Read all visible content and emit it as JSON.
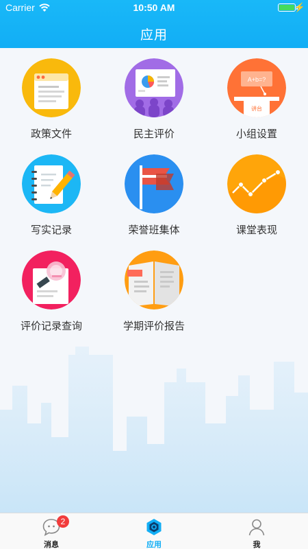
{
  "status_bar": {
    "carrier": "Carrier",
    "time": "10:50 AM",
    "battery_level": 1.0
  },
  "header": {
    "title": "应用"
  },
  "apps": [
    {
      "label": "政策文件",
      "icon": "policy-document-icon",
      "color": "#f9b90c"
    },
    {
      "label": "民主评价",
      "icon": "presentation-icon",
      "color": "#a16ce6"
    },
    {
      "label": "小组设置",
      "icon": "lectern-icon",
      "color": "#ff7236",
      "board_text": "A+b=?",
      "podium_text": "讲台"
    },
    {
      "label": "写实记录",
      "icon": "notebook-pencil-icon",
      "color": "#1cb7f5"
    },
    {
      "label": "荣誉班集体",
      "icon": "flag-icon",
      "color": "#2a8ff0"
    },
    {
      "label": "课堂表现",
      "icon": "line-chart-icon",
      "color": "#ffa50a"
    },
    {
      "label": "评价记录查询",
      "icon": "stamped-document-icon",
      "color": "#f2215f"
    },
    {
      "label": "学期评价报告",
      "icon": "open-book-icon",
      "color": "#ff9d12"
    }
  ],
  "tabbar": {
    "tabs": [
      {
        "label": "消息",
        "icon": "chat-bubble-icon",
        "badge": "2",
        "active": false
      },
      {
        "label": "应用",
        "icon": "hexagon-icon",
        "active": true
      },
      {
        "label": "我",
        "icon": "user-icon",
        "active": false
      }
    ]
  },
  "colors": {
    "header": "#12aef5",
    "active_tab": "#12aef5",
    "badge": "#f23c3c",
    "background": "#f4f7fb"
  }
}
